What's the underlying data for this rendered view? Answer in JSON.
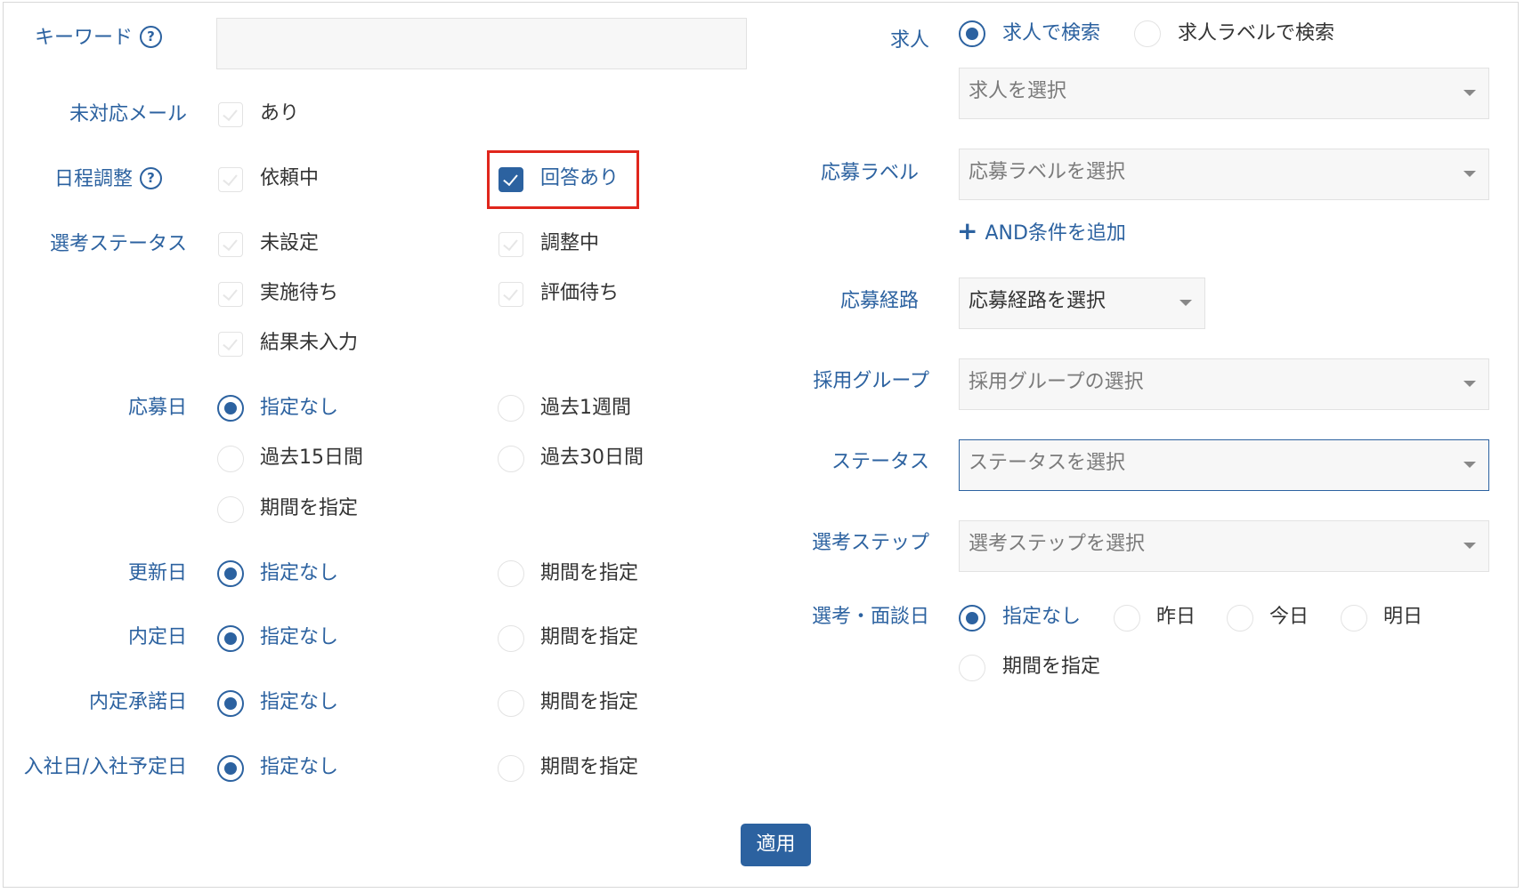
{
  "left": {
    "keyword": {
      "label": "キーワード",
      "help": "?",
      "value": ""
    },
    "unresponded_mail": {
      "label": "未対応メール",
      "option": "あり"
    },
    "schedule": {
      "label": "日程調整",
      "help": "?",
      "options": [
        "依頼中",
        "回答あり"
      ]
    },
    "selection_status": {
      "label": "選考ステータス",
      "options": [
        "未設定",
        "調整中",
        "実施待ち",
        "評価待ち",
        "結果未入力"
      ]
    },
    "apply_date": {
      "label": "応募日",
      "options": [
        "指定なし",
        "過去1週間",
        "過去15日間",
        "過去30日間",
        "期間を指定"
      ]
    },
    "update_date": {
      "label": "更新日",
      "options": [
        "指定なし",
        "期間を指定"
      ]
    },
    "offer_date": {
      "label": "内定日",
      "options": [
        "指定なし",
        "期間を指定"
      ]
    },
    "offer_accept_date": {
      "label": "内定承諾日",
      "options": [
        "指定なし",
        "期間を指定"
      ]
    },
    "join_date": {
      "label": "入社日/入社予定日",
      "options": [
        "指定なし",
        "期間を指定"
      ]
    }
  },
  "right": {
    "job": {
      "label": "求人",
      "options": [
        "求人で検索",
        "求人ラベルで検索"
      ],
      "placeholder": "求人を選択"
    },
    "apply_label": {
      "label": "応募ラベル",
      "placeholder": "応募ラベルを選択",
      "add_condition": "AND条件を追加",
      "plus": "+"
    },
    "route": {
      "label": "応募経路",
      "placeholder": "応募経路を選択"
    },
    "group": {
      "label": "採用グループ",
      "placeholder": "採用グループの選択"
    },
    "status": {
      "label": "ステータス",
      "placeholder": "ステータスを選択"
    },
    "step": {
      "label": "選考ステップ",
      "placeholder": "選考ステップを選択"
    },
    "interview_date": {
      "label": "選考・面談日",
      "options": [
        "指定なし",
        "昨日",
        "今日",
        "明日",
        "期間を指定"
      ]
    }
  },
  "apply_button": "適用",
  "colors": {
    "primary": "#2c62a0",
    "highlight": "#e0261c"
  }
}
